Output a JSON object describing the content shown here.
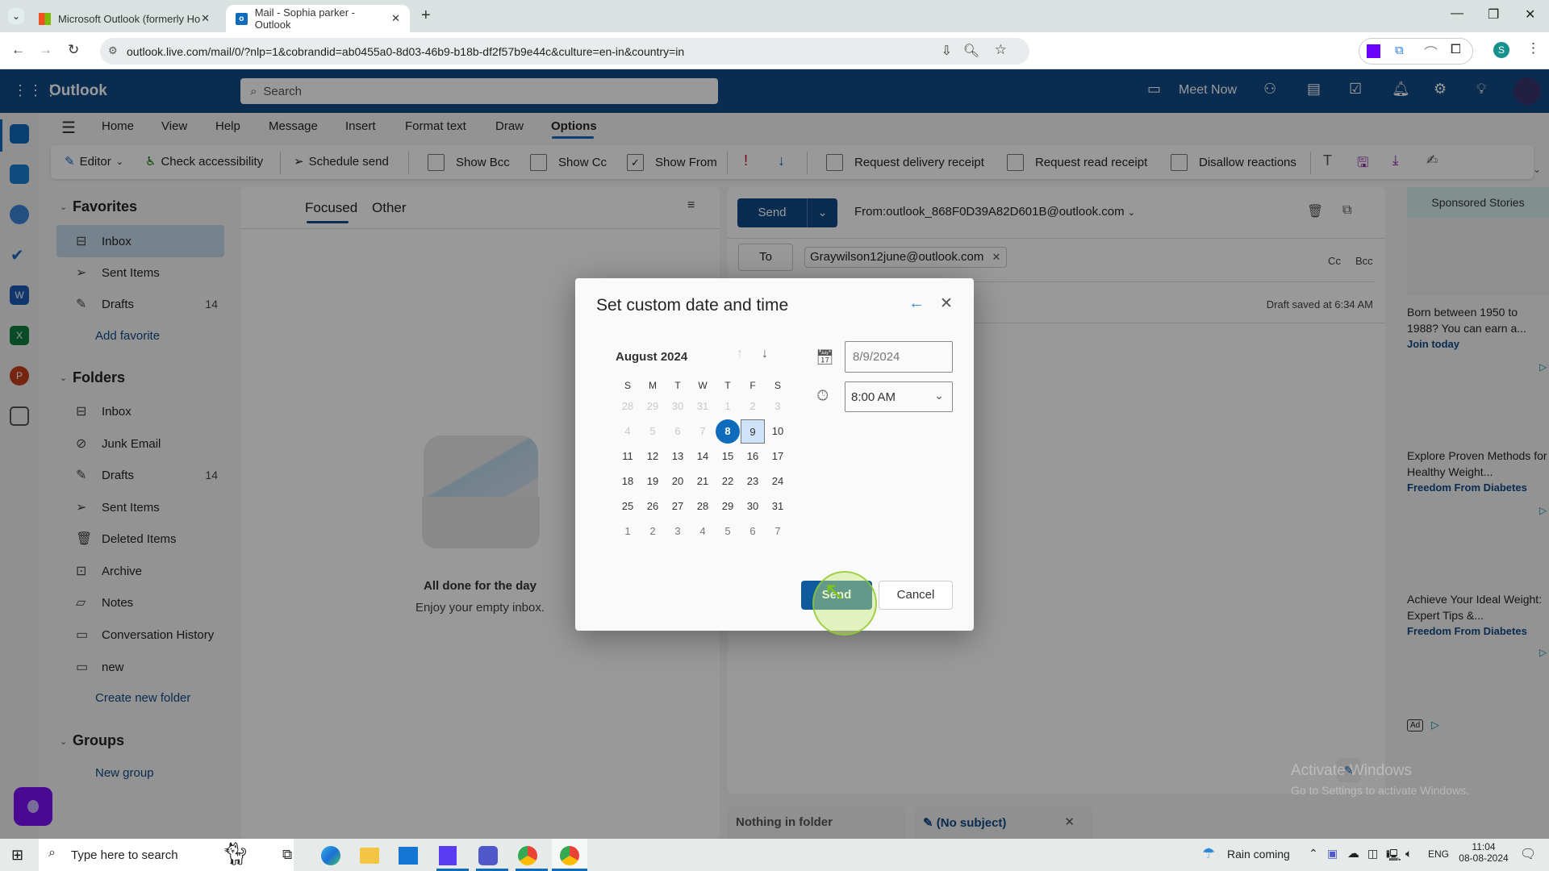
{
  "browser": {
    "tabs": [
      {
        "label": "Microsoft Outlook (formerly Ho",
        "icon": "microsoft-logo-icon",
        "active": false
      },
      {
        "label": "Mail - Sophia parker - Outlook",
        "icon": "outlook-icon",
        "active": true
      }
    ],
    "url": "outlook.live.com/mail/0/?nlp=1&cobrandid=ab0455a0-8d03-46b9-b18b-df2f57b9e44c&culture=en-in&country=in",
    "profile_initial": "S"
  },
  "header": {
    "app_name": "Outlook",
    "search_placeholder": "Search",
    "meet_now": "Meet Now"
  },
  "menu_tabs": [
    "Home",
    "View",
    "Help",
    "Message",
    "Insert",
    "Format text",
    "Draw",
    "Options"
  ],
  "active_menu_tab": "Options",
  "ribbon": {
    "editor": "Editor",
    "check_accessibility": "Check accessibility",
    "schedule_send": "Schedule send",
    "show_bcc": {
      "label": "Show Bcc",
      "checked": false
    },
    "show_cc": {
      "label": "Show Cc",
      "checked": false
    },
    "show_from": {
      "label": "Show From",
      "checked": true
    },
    "request_delivery": {
      "label": "Request delivery receipt",
      "checked": false
    },
    "request_read": {
      "label": "Request read receipt",
      "checked": false
    },
    "disallow_reactions": {
      "label": "Disallow reactions",
      "checked": false
    }
  },
  "folders": {
    "favorites_label": "Favorites",
    "favorites": [
      {
        "label": "Inbox",
        "icon": "inbox-icon",
        "count": ""
      },
      {
        "label": "Sent Items",
        "icon": "send-icon",
        "count": ""
      },
      {
        "label": "Drafts",
        "icon": "drafts-icon",
        "count": "14"
      }
    ],
    "add_favorite": "Add favorite",
    "folders_label": "Folders",
    "items": [
      {
        "label": "Inbox",
        "icon": "inbox-icon",
        "count": ""
      },
      {
        "label": "Junk Email",
        "icon": "junk-icon",
        "count": ""
      },
      {
        "label": "Drafts",
        "icon": "drafts-icon",
        "count": "14"
      },
      {
        "label": "Sent Items",
        "icon": "send-icon",
        "count": ""
      },
      {
        "label": "Deleted Items",
        "icon": "trash-icon",
        "count": ""
      },
      {
        "label": "Archive",
        "icon": "archive-icon",
        "count": ""
      },
      {
        "label": "Notes",
        "icon": "note-icon",
        "count": ""
      },
      {
        "label": "Conversation History",
        "icon": "folder-icon",
        "count": ""
      },
      {
        "label": "new",
        "icon": "folder-icon",
        "count": ""
      }
    ],
    "create_folder": "Create new folder",
    "groups_label": "Groups",
    "new_group": "New group"
  },
  "message_list": {
    "tab_focused": "Focused",
    "tab_other": "Other",
    "empty_title": "All done for the day",
    "empty_subtitle": "Enjoy your empty inbox."
  },
  "compose": {
    "send": "Send",
    "from": "From:outlook_868F0D39A82D601B@outlook.com",
    "to_label": "To",
    "recipient": "Graywilson12june@outlook.com",
    "cc": "Cc",
    "bcc": "Bcc",
    "draft_saved": "Draft saved at 6:34 AM"
  },
  "ads": {
    "header": "Sponsored Stories",
    "items": [
      {
        "title": "Born between 1950 to 1988? You can earn a...",
        "source": "Join today"
      },
      {
        "title": "Explore Proven Methods for Healthy Weight...",
        "source": "Freedom From Diabetes"
      },
      {
        "title": "Achieve Your Ideal Weight: Expert Tips &...",
        "source": "Freedom From Diabetes"
      }
    ],
    "ad_badge": "Ad"
  },
  "bottom_tabs": {
    "nothing": "Nothing in folder",
    "draft": "(No subject)"
  },
  "watermark": {
    "title": "Activate Windows",
    "subtitle": "Go to Settings to activate Windows."
  },
  "dialog": {
    "title": "Set custom date and time",
    "month": "August 2024",
    "weekdays": [
      "S",
      "M",
      "T",
      "W",
      "T",
      "F",
      "S"
    ],
    "weeks": [
      [
        "28",
        "29",
        "30",
        "31",
        "1",
        "2",
        "3"
      ],
      [
        "4",
        "5",
        "6",
        "7",
        "8",
        "9",
        "10"
      ],
      [
        "11",
        "12",
        "13",
        "14",
        "15",
        "16",
        "17"
      ],
      [
        "18",
        "19",
        "20",
        "21",
        "22",
        "23",
        "24"
      ],
      [
        "25",
        "26",
        "27",
        "28",
        "29",
        "30",
        "31"
      ],
      [
        "1",
        "2",
        "3",
        "4",
        "5",
        "6",
        "7"
      ]
    ],
    "today": "8",
    "selected": "9",
    "date_value": "8/9/2024",
    "time_value": "8:00 AM",
    "send": "Send",
    "cancel": "Cancel"
  },
  "taskbar": {
    "search_placeholder": "Type here to search",
    "weather": "Rain coming",
    "language": "ENG",
    "time": "11:04",
    "date": "08-08-2024"
  }
}
